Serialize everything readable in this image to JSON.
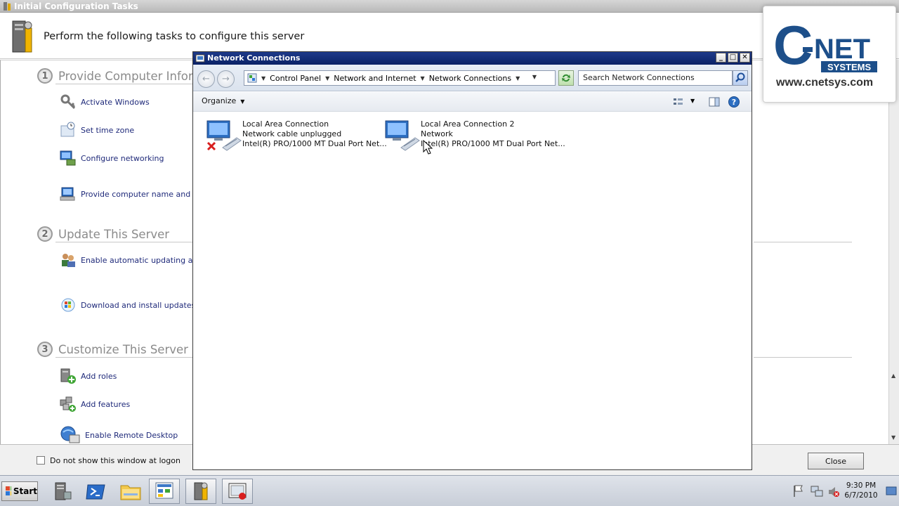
{
  "background_window": {
    "title": "Initial Configuration Tasks",
    "header_text": "Perform the following tasks to configure this server",
    "sections": [
      {
        "number": "1",
        "title": "Provide Computer Infor",
        "tasks": [
          "Activate Windows",
          "Set time zone",
          "Configure networking",
          "Provide computer name and doma"
        ]
      },
      {
        "number": "2",
        "title": "Update This Server",
        "tasks": [
          "Enable automatic updating and fe",
          "Download and install updates"
        ]
      },
      {
        "number": "3",
        "title": "Customize This Server",
        "tasks": [
          "Add roles",
          "Add features",
          "Enable Remote Desktop"
        ]
      }
    ],
    "dont_show_label": "Do not show this window at logon",
    "close_label": "Close"
  },
  "logo": {
    "url_text": "www.cnetsys.com",
    "brand_colors": {
      "primary": "#1d4f8a",
      "text": "#333333"
    }
  },
  "network_window": {
    "title": "Network Connections",
    "breadcrumbs": [
      "Control Panel",
      "Network and Internet",
      "Network Connections"
    ],
    "search_placeholder": "Search Network Connections",
    "organize_label": "Organize",
    "connections": [
      {
        "name": "Local Area Connection",
        "status": "Network cable unplugged",
        "adapter": "Intel(R) PRO/1000 MT Dual Port Net...",
        "status_icon": "red-x-icon"
      },
      {
        "name": "Local Area Connection 2",
        "status": "Network",
        "adapter": "Intel(R) PRO/1000 MT Dual Port Net...",
        "status_icon": "none"
      }
    ]
  },
  "taskbar": {
    "start_label": "Start",
    "apps": [
      "server-manager-icon",
      "powershell-icon",
      "explorer-folder-icon",
      "network-connections-icon",
      "initial-config-icon",
      "recorder-icon"
    ],
    "clock_time": "9:30 PM",
    "clock_date": "6/7/2010"
  }
}
